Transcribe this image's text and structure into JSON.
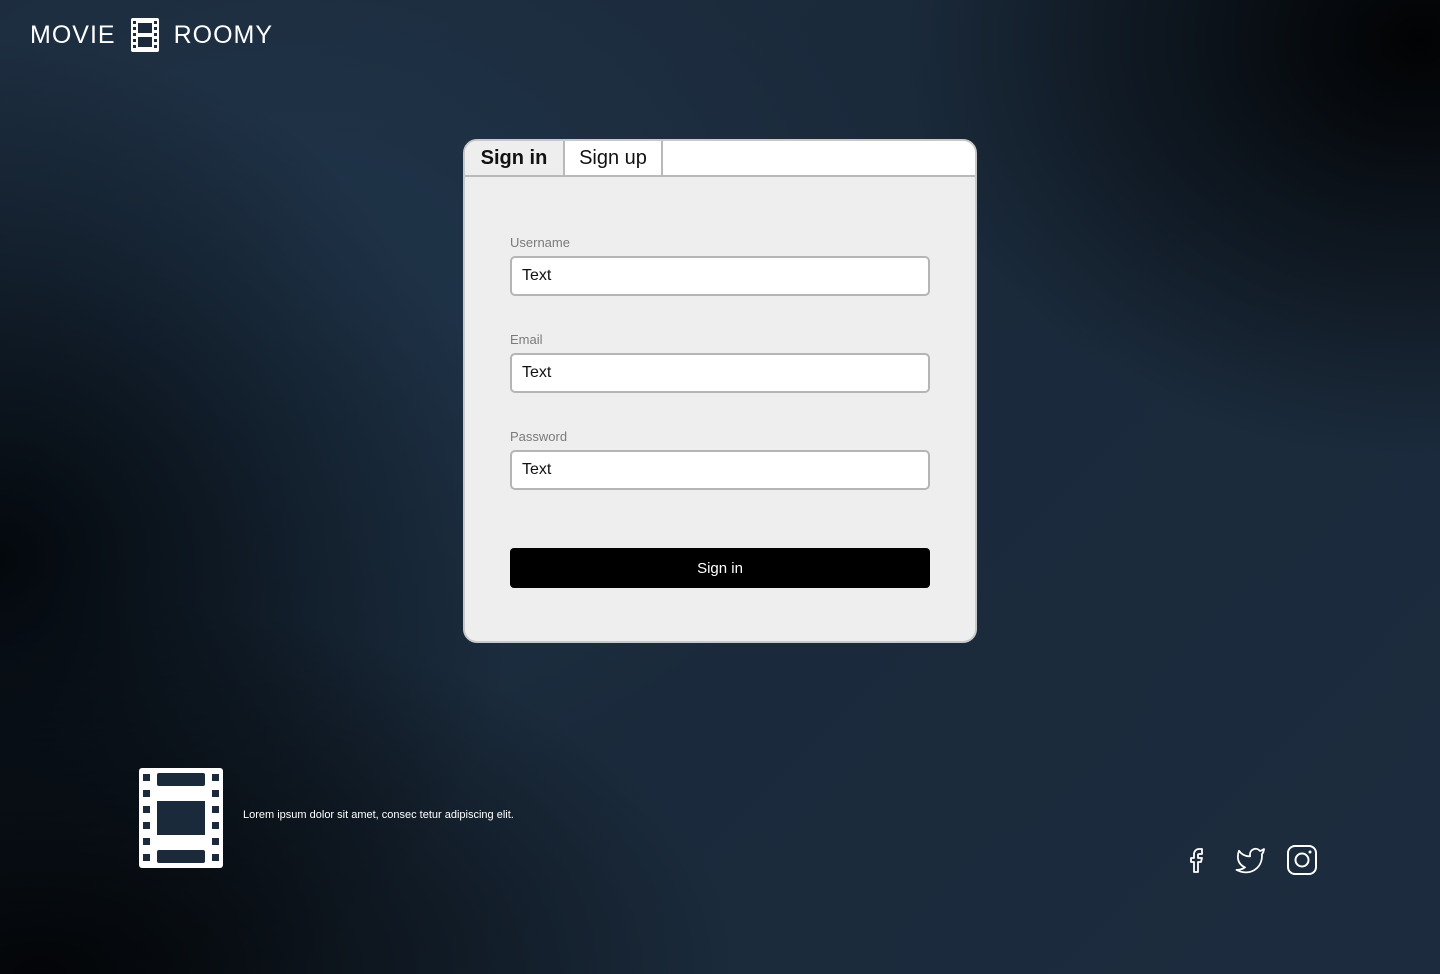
{
  "header": {
    "logo_left": "MOVIE",
    "logo_right": "ROOMY",
    "logo_icon": "film-strip-icon"
  },
  "auth": {
    "tabs": [
      {
        "label": "Sign in",
        "active": true
      },
      {
        "label": "Sign up",
        "active": false
      }
    ],
    "fields": {
      "username": {
        "label": "Username",
        "value": "Text"
      },
      "email": {
        "label": "Email",
        "value": "Text"
      },
      "password": {
        "label": "Password",
        "value": "Text"
      }
    },
    "submit_label": "Sign in"
  },
  "footer": {
    "logo_icon": "film-strip-icon",
    "text": "Lorem ipsum dolor sit amet, consec tetur adipiscing elit.",
    "social": [
      {
        "name": "facebook-icon"
      },
      {
        "name": "twitter-icon"
      },
      {
        "name": "instagram-icon"
      }
    ]
  },
  "colors": {
    "background": "#1b2a3a",
    "card": "#eeeeee",
    "button": "#000000"
  }
}
